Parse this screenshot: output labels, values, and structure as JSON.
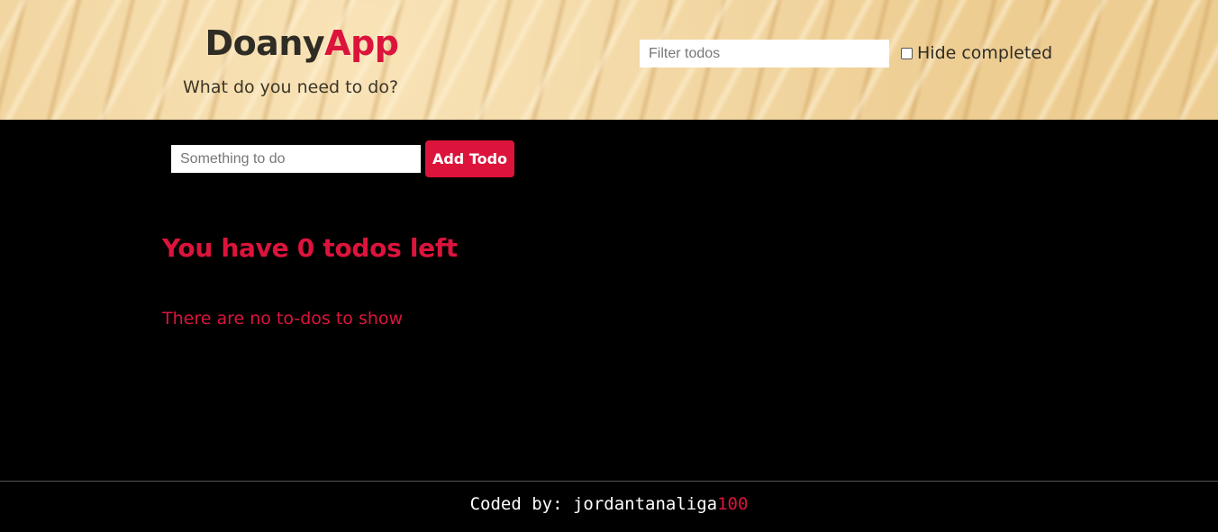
{
  "header": {
    "brand_primary": "Doany",
    "brand_accent": "App",
    "subtitle": "What do you need to do?",
    "filter_placeholder": "Filter todos",
    "filter_value": "",
    "hide_completed_label": "Hide completed",
    "hide_completed_checked": false
  },
  "add_form": {
    "input_placeholder": "Something to do",
    "input_value": "",
    "button_label": "Add Todo"
  },
  "todos": {
    "summary": "You have 0 todos left",
    "empty_message": "There are no to-dos to show",
    "items": []
  },
  "footer": {
    "prefix": "Coded by: ",
    "author": "jordantanaliga",
    "author_suffix": "100"
  },
  "colors": {
    "accent": "#dc143c",
    "background": "#000000",
    "header_sand": "#efd199",
    "text_dark": "#2f2c25"
  }
}
